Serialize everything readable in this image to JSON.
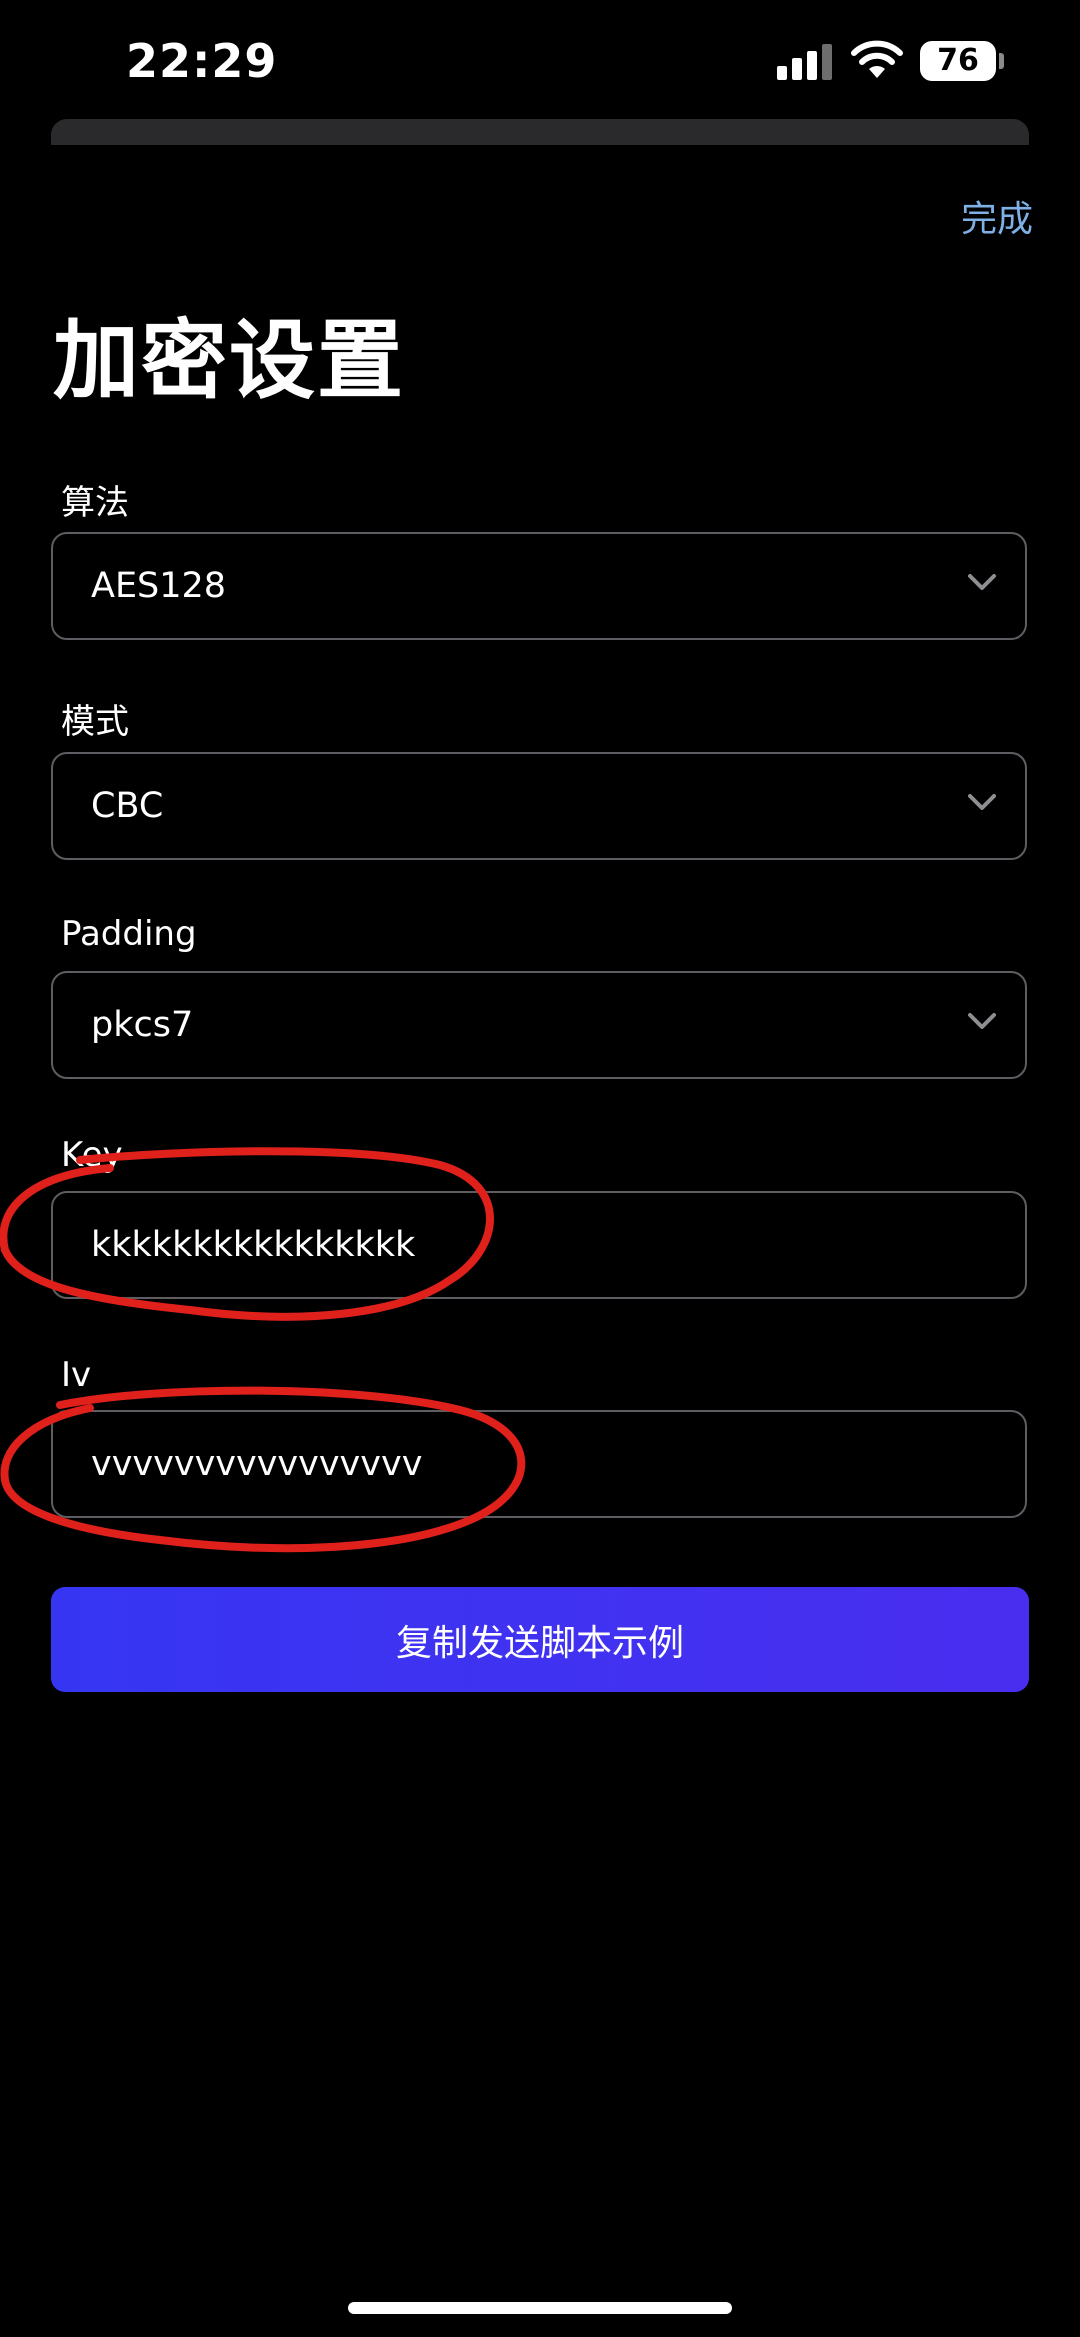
{
  "status_bar": {
    "time": "22:29",
    "battery": "76",
    "icons": [
      "signal-icon",
      "wifi-icon",
      "battery-icon"
    ]
  },
  "header": {
    "done_label": "完成",
    "title": "加密设置"
  },
  "form": {
    "algorithm": {
      "label": "算法",
      "value": "AES128"
    },
    "mode": {
      "label": "模式",
      "value": "CBC"
    },
    "padding": {
      "label": "Padding",
      "value": "pkcs7"
    },
    "key": {
      "label": "Key",
      "value": "kkkkkkkkkkkkkkkk"
    },
    "iv": {
      "label": "Iv",
      "value": "vvvvvvvvvvvvvvvv"
    }
  },
  "actions": {
    "copy_script_label": "复制发送脚本示例"
  },
  "colors": {
    "background": "#000000",
    "accent_link": "#7fb0e6",
    "button_start": "#3636f2",
    "button_end": "#4a2ef0",
    "field_border": "#5d5d62",
    "annotation": "#e0201b"
  }
}
